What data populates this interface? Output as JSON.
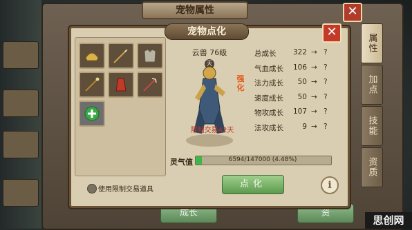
{
  "outer": {
    "title": "宠物属性",
    "tabs": [
      "属性",
      "加点",
      "技能",
      "资质"
    ],
    "bottom_buttons": [
      "成长",
      "资"
    ]
  },
  "dialog": {
    "title": "宠物点化",
    "pet_name": "云兽 76级",
    "pet_emblem": "天",
    "badge": "强化",
    "restriction": "限制交易42天",
    "stats": [
      {
        "name": "总成长",
        "value": "322",
        "arrow": "→",
        "next": "?"
      },
      {
        "name": "气血成长",
        "value": "106",
        "arrow": "→",
        "next": "?"
      },
      {
        "name": "法力成长",
        "value": "50",
        "arrow": "→",
        "next": "?"
      },
      {
        "name": "速度成长",
        "value": "50",
        "arrow": "→",
        "next": "?"
      },
      {
        "name": "物攻成长",
        "value": "107",
        "arrow": "→",
        "next": "?"
      },
      {
        "name": "法攻成长",
        "value": "9",
        "arrow": "→",
        "next": "?"
      }
    ],
    "spirit_label": "灵气值",
    "spirit_text": "6594/147000 (4.48%)",
    "spirit_fraction": 0.0448,
    "use_restricted_label": "使用限制交易道具",
    "enhance_button": "点化",
    "info_icon": "i"
  },
  "watermark": "思创网",
  "items": [
    "helmet-icon",
    "spear-icon",
    "armor-icon",
    "staff-icon",
    "robe-icon",
    "trident-icon",
    "add-icon"
  ]
}
